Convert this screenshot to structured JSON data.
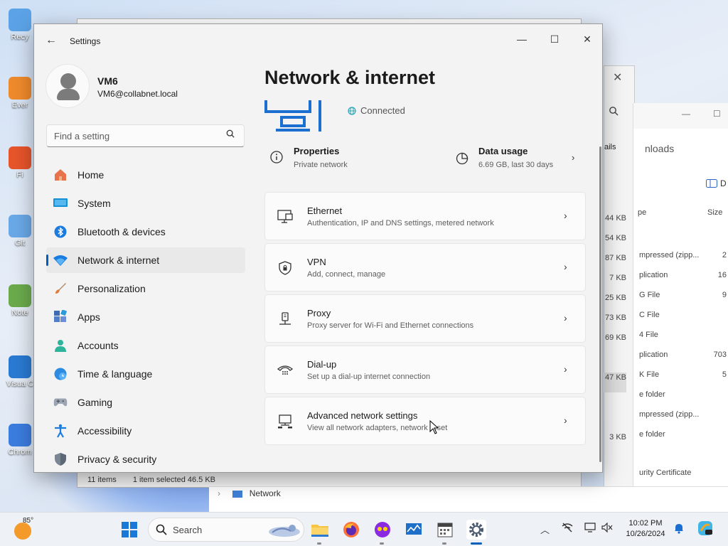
{
  "desktop": {
    "icons": [
      {
        "label": "Recy",
        "color": "#5ba3e6"
      },
      {
        "label": "Ever",
        "color": "#f08b2c"
      },
      {
        "label": "Fi",
        "color": "#e8552b"
      },
      {
        "label": "Git",
        "color": "#6aa9e8"
      },
      {
        "label": "Note",
        "color": "#6bab4c"
      },
      {
        "label": "Visua\nC",
        "color": "#2a7ad4"
      },
      {
        "label": "Chrom",
        "color": "#3b7de0"
      }
    ]
  },
  "explorer": {
    "status_items": "11 items",
    "status_selected": "1 item selected  46.5 KB",
    "nav_item": "Network",
    "partial_tab": "ails",
    "partial_title": "nloads",
    "col_type": "pe",
    "col_size": "Size",
    "view_label": "D",
    "sizes": [
      "44 KB",
      "54 KB",
      "87 KB",
      "7 KB",
      "25 KB",
      "73 KB",
      "69 KB",
      "",
      "47 KB",
      "",
      "",
      "3 KB"
    ],
    "types": [
      "mpressed (zipp...",
      "plication",
      "G File",
      "C File",
      "4 File",
      "plication",
      "K File",
      "e folder",
      "mpressed (zipp...",
      "e folder"
    ],
    "type_sizes": [
      "2",
      "16",
      "9",
      "",
      "",
      "703",
      "5",
      "",
      "",
      ""
    ],
    "cert": "urity Certificate"
  },
  "settings": {
    "app_title": "Settings",
    "window_buttons": {
      "minimize": "—",
      "maximize": "☐",
      "close": "✕"
    },
    "profile": {
      "name": "VM6",
      "email": "VM6@collabnet.local"
    },
    "search_placeholder": "Find a setting",
    "nav": [
      {
        "label": "Home",
        "icon": "home-icon",
        "active": false
      },
      {
        "label": "System",
        "icon": "system-icon",
        "active": false
      },
      {
        "label": "Bluetooth & devices",
        "icon": "bluetooth-icon",
        "active": false
      },
      {
        "label": "Network & internet",
        "icon": "wifi-icon",
        "active": true
      },
      {
        "label": "Personalization",
        "icon": "brush-icon",
        "active": false
      },
      {
        "label": "Apps",
        "icon": "apps-icon",
        "active": false
      },
      {
        "label": "Accounts",
        "icon": "person-icon",
        "active": false
      },
      {
        "label": "Time & language",
        "icon": "globe-clock-icon",
        "active": false
      },
      {
        "label": "Gaming",
        "icon": "gamepad-icon",
        "active": false
      },
      {
        "label": "Accessibility",
        "icon": "accessibility-icon",
        "active": false
      },
      {
        "label": "Privacy & security",
        "icon": "shield-icon",
        "active": false
      }
    ],
    "page_title": "Network & internet",
    "status": "Connected",
    "properties": {
      "title": "Properties",
      "subtitle": "Private network"
    },
    "data_usage": {
      "title": "Data usage",
      "subtitle": "6.69 GB, last 30 days"
    },
    "cards": [
      {
        "title": "Ethernet",
        "subtitle": "Authentication, IP and DNS settings, metered network",
        "icon": "ethernet-icon"
      },
      {
        "title": "VPN",
        "subtitle": "Add, connect, manage",
        "icon": "vpn-shield-icon"
      },
      {
        "title": "Proxy",
        "subtitle": "Proxy server for Wi-Fi and Ethernet connections",
        "icon": "proxy-icon"
      },
      {
        "title": "Dial-up",
        "subtitle": "Set up a dial-up internet connection",
        "icon": "dialup-icon"
      },
      {
        "title": "Advanced network settings",
        "subtitle": "View all network adapters, network reset",
        "icon": "advanced-network-icon"
      }
    ]
  },
  "taskbar": {
    "temperature": "85°",
    "search_label": "Search",
    "time": "10:02 PM",
    "date": "10/26/2024",
    "accent": "#005fb8"
  }
}
